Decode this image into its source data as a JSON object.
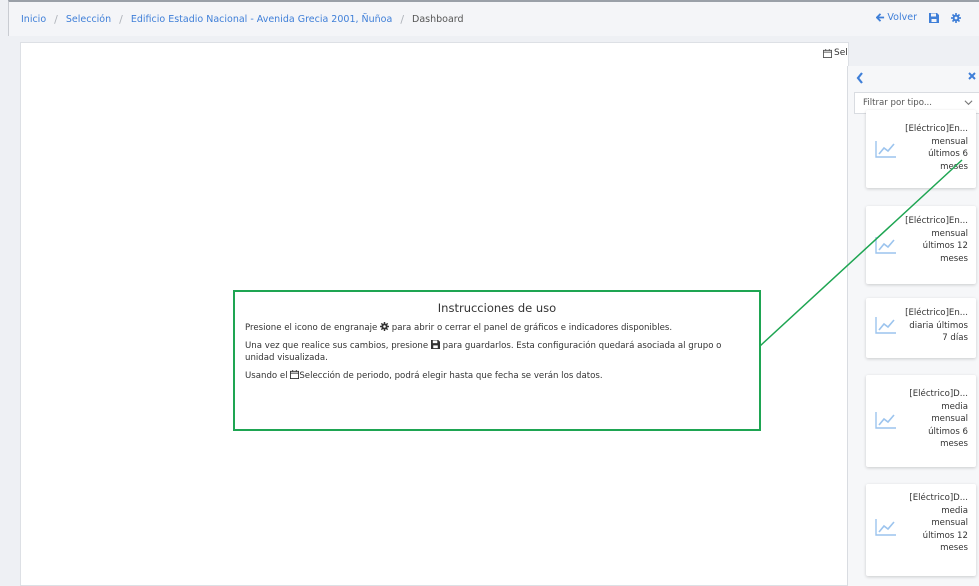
{
  "breadcrumb": {
    "items": [
      "Inicio",
      "Selección",
      "Edificio Estadio Nacional - Avenida Grecia 2001, Ñuñoa",
      "Dashboard"
    ]
  },
  "toolbar": {
    "back_label": "Volver",
    "save_icon": "floppy-save-icon",
    "settings_icon": "gear-icon"
  },
  "period_selector": {
    "label": "Sel"
  },
  "instructions": {
    "title": "Instrucciones de uso",
    "line1_before": "Presione el icono de engranaje ",
    "line1_after": " para abrir o cerrar el panel de gráficos e indicadores disponibles.",
    "line2_before": "Una vez que realice sus cambios, presione ",
    "line2_after": " para guardarlos. Esta configuración quedará asociada al grupo o unidad visualizada.",
    "line3_before": "Usando el ",
    "line3_after": "Selección de periodo, podrá elegir hasta que fecha se verán los datos."
  },
  "panel": {
    "filter_placeholder": "Filtrar por tipo...",
    "cards": [
      {
        "lines": [
          "[Eléctrico]En...",
          "mensual",
          "últimos 6",
          "meses"
        ]
      },
      {
        "lines": [
          "[Eléctrico]En...",
          "mensual",
          "últimos 12",
          "meses"
        ]
      },
      {
        "lines": [
          "[Eléctrico]En...",
          "diaria últimos",
          "7 días"
        ]
      },
      {
        "lines": [
          "[Eléctrico]D...",
          "media",
          "mensual",
          "últimos 6",
          "meses"
        ]
      },
      {
        "lines": [
          "[Eléctrico]D...",
          "media",
          "mensual",
          "últimos 12",
          "meses"
        ]
      }
    ]
  },
  "colors": {
    "accent": "#3f7fd8",
    "highlight_border": "#1ea552"
  }
}
